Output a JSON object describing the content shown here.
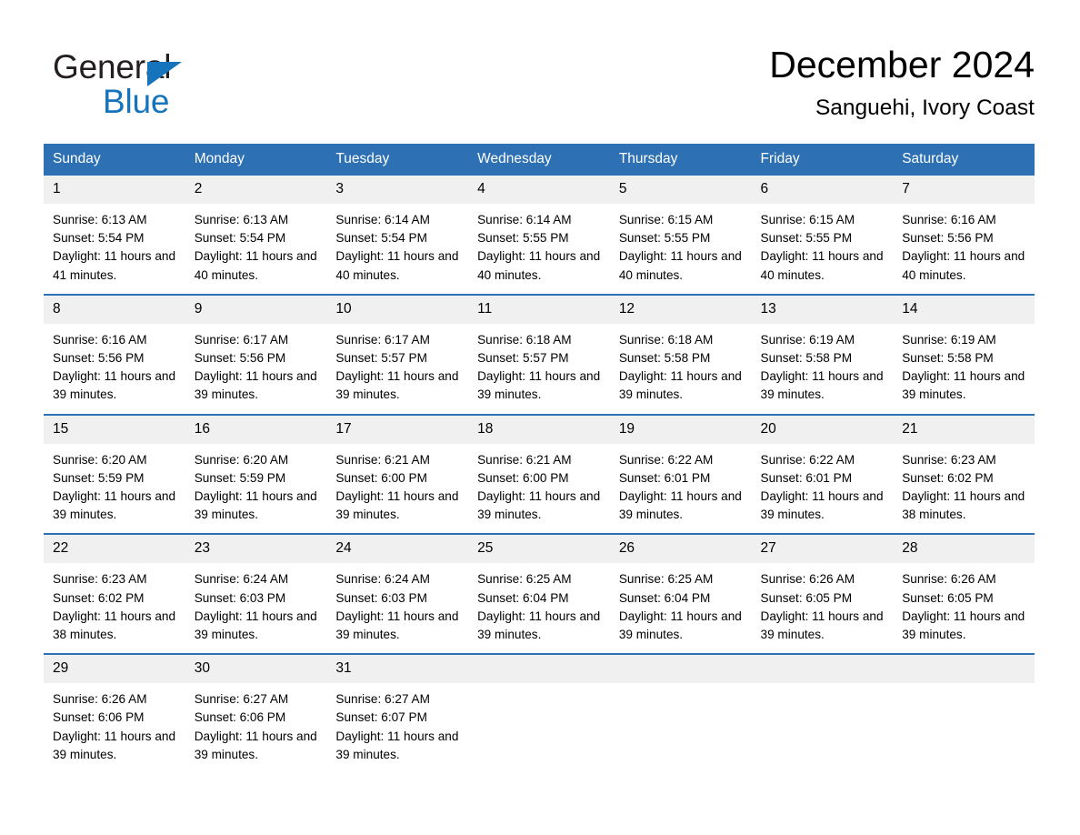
{
  "brand": {
    "name_top": "General",
    "name_bottom": "Blue",
    "triangle_color": "#1574bb",
    "text_color": "#231f20"
  },
  "header": {
    "title": "December 2024",
    "subtitle": "Sanguehi, Ivory Coast"
  },
  "theme": {
    "header_blue": "#2d70b3",
    "row_divider_blue": "#2d70b3",
    "daynum_background": "#f0f0f0",
    "page_background": "#ffffff"
  },
  "weekday_headers": [
    "Sunday",
    "Monday",
    "Tuesday",
    "Wednesday",
    "Thursday",
    "Friday",
    "Saturday"
  ],
  "weeks": [
    [
      {
        "day": "1",
        "sunrise": "Sunrise: 6:13 AM",
        "sunset": "Sunset: 5:54 PM",
        "daylight": "Daylight: 11 hours and 41 minutes."
      },
      {
        "day": "2",
        "sunrise": "Sunrise: 6:13 AM",
        "sunset": "Sunset: 5:54 PM",
        "daylight": "Daylight: 11 hours and 40 minutes."
      },
      {
        "day": "3",
        "sunrise": "Sunrise: 6:14 AM",
        "sunset": "Sunset: 5:54 PM",
        "daylight": "Daylight: 11 hours and 40 minutes."
      },
      {
        "day": "4",
        "sunrise": "Sunrise: 6:14 AM",
        "sunset": "Sunset: 5:55 PM",
        "daylight": "Daylight: 11 hours and 40 minutes."
      },
      {
        "day": "5",
        "sunrise": "Sunrise: 6:15 AM",
        "sunset": "Sunset: 5:55 PM",
        "daylight": "Daylight: 11 hours and 40 minutes."
      },
      {
        "day": "6",
        "sunrise": "Sunrise: 6:15 AM",
        "sunset": "Sunset: 5:55 PM",
        "daylight": "Daylight: 11 hours and 40 minutes."
      },
      {
        "day": "7",
        "sunrise": "Sunrise: 6:16 AM",
        "sunset": "Sunset: 5:56 PM",
        "daylight": "Daylight: 11 hours and 40 minutes."
      }
    ],
    [
      {
        "day": "8",
        "sunrise": "Sunrise: 6:16 AM",
        "sunset": "Sunset: 5:56 PM",
        "daylight": "Daylight: 11 hours and 39 minutes."
      },
      {
        "day": "9",
        "sunrise": "Sunrise: 6:17 AM",
        "sunset": "Sunset: 5:56 PM",
        "daylight": "Daylight: 11 hours and 39 minutes."
      },
      {
        "day": "10",
        "sunrise": "Sunrise: 6:17 AM",
        "sunset": "Sunset: 5:57 PM",
        "daylight": "Daylight: 11 hours and 39 minutes."
      },
      {
        "day": "11",
        "sunrise": "Sunrise: 6:18 AM",
        "sunset": "Sunset: 5:57 PM",
        "daylight": "Daylight: 11 hours and 39 minutes."
      },
      {
        "day": "12",
        "sunrise": "Sunrise: 6:18 AM",
        "sunset": "Sunset: 5:58 PM",
        "daylight": "Daylight: 11 hours and 39 minutes."
      },
      {
        "day": "13",
        "sunrise": "Sunrise: 6:19 AM",
        "sunset": "Sunset: 5:58 PM",
        "daylight": "Daylight: 11 hours and 39 minutes."
      },
      {
        "day": "14",
        "sunrise": "Sunrise: 6:19 AM",
        "sunset": "Sunset: 5:58 PM",
        "daylight": "Daylight: 11 hours and 39 minutes."
      }
    ],
    [
      {
        "day": "15",
        "sunrise": "Sunrise: 6:20 AM",
        "sunset": "Sunset: 5:59 PM",
        "daylight": "Daylight: 11 hours and 39 minutes."
      },
      {
        "day": "16",
        "sunrise": "Sunrise: 6:20 AM",
        "sunset": "Sunset: 5:59 PM",
        "daylight": "Daylight: 11 hours and 39 minutes."
      },
      {
        "day": "17",
        "sunrise": "Sunrise: 6:21 AM",
        "sunset": "Sunset: 6:00 PM",
        "daylight": "Daylight: 11 hours and 39 minutes."
      },
      {
        "day": "18",
        "sunrise": "Sunrise: 6:21 AM",
        "sunset": "Sunset: 6:00 PM",
        "daylight": "Daylight: 11 hours and 39 minutes."
      },
      {
        "day": "19",
        "sunrise": "Sunrise: 6:22 AM",
        "sunset": "Sunset: 6:01 PM",
        "daylight": "Daylight: 11 hours and 39 minutes."
      },
      {
        "day": "20",
        "sunrise": "Sunrise: 6:22 AM",
        "sunset": "Sunset: 6:01 PM",
        "daylight": "Daylight: 11 hours and 39 minutes."
      },
      {
        "day": "21",
        "sunrise": "Sunrise: 6:23 AM",
        "sunset": "Sunset: 6:02 PM",
        "daylight": "Daylight: 11 hours and 38 minutes."
      }
    ],
    [
      {
        "day": "22",
        "sunrise": "Sunrise: 6:23 AM",
        "sunset": "Sunset: 6:02 PM",
        "daylight": "Daylight: 11 hours and 38 minutes."
      },
      {
        "day": "23",
        "sunrise": "Sunrise: 6:24 AM",
        "sunset": "Sunset: 6:03 PM",
        "daylight": "Daylight: 11 hours and 39 minutes."
      },
      {
        "day": "24",
        "sunrise": "Sunrise: 6:24 AM",
        "sunset": "Sunset: 6:03 PM",
        "daylight": "Daylight: 11 hours and 39 minutes."
      },
      {
        "day": "25",
        "sunrise": "Sunrise: 6:25 AM",
        "sunset": "Sunset: 6:04 PM",
        "daylight": "Daylight: 11 hours and 39 minutes."
      },
      {
        "day": "26",
        "sunrise": "Sunrise: 6:25 AM",
        "sunset": "Sunset: 6:04 PM",
        "daylight": "Daylight: 11 hours and 39 minutes."
      },
      {
        "day": "27",
        "sunrise": "Sunrise: 6:26 AM",
        "sunset": "Sunset: 6:05 PM",
        "daylight": "Daylight: 11 hours and 39 minutes."
      },
      {
        "day": "28",
        "sunrise": "Sunrise: 6:26 AM",
        "sunset": "Sunset: 6:05 PM",
        "daylight": "Daylight: 11 hours and 39 minutes."
      }
    ],
    [
      {
        "day": "29",
        "sunrise": "Sunrise: 6:26 AM",
        "sunset": "Sunset: 6:06 PM",
        "daylight": "Daylight: 11 hours and 39 minutes."
      },
      {
        "day": "30",
        "sunrise": "Sunrise: 6:27 AM",
        "sunset": "Sunset: 6:06 PM",
        "daylight": "Daylight: 11 hours and 39 minutes."
      },
      {
        "day": "31",
        "sunrise": "Sunrise: 6:27 AM",
        "sunset": "Sunset: 6:07 PM",
        "daylight": "Daylight: 11 hours and 39 minutes."
      },
      {
        "day": "",
        "sunrise": "",
        "sunset": "",
        "daylight": ""
      },
      {
        "day": "",
        "sunrise": "",
        "sunset": "",
        "daylight": ""
      },
      {
        "day": "",
        "sunrise": "",
        "sunset": "",
        "daylight": ""
      },
      {
        "day": "",
        "sunrise": "",
        "sunset": "",
        "daylight": ""
      }
    ]
  ]
}
